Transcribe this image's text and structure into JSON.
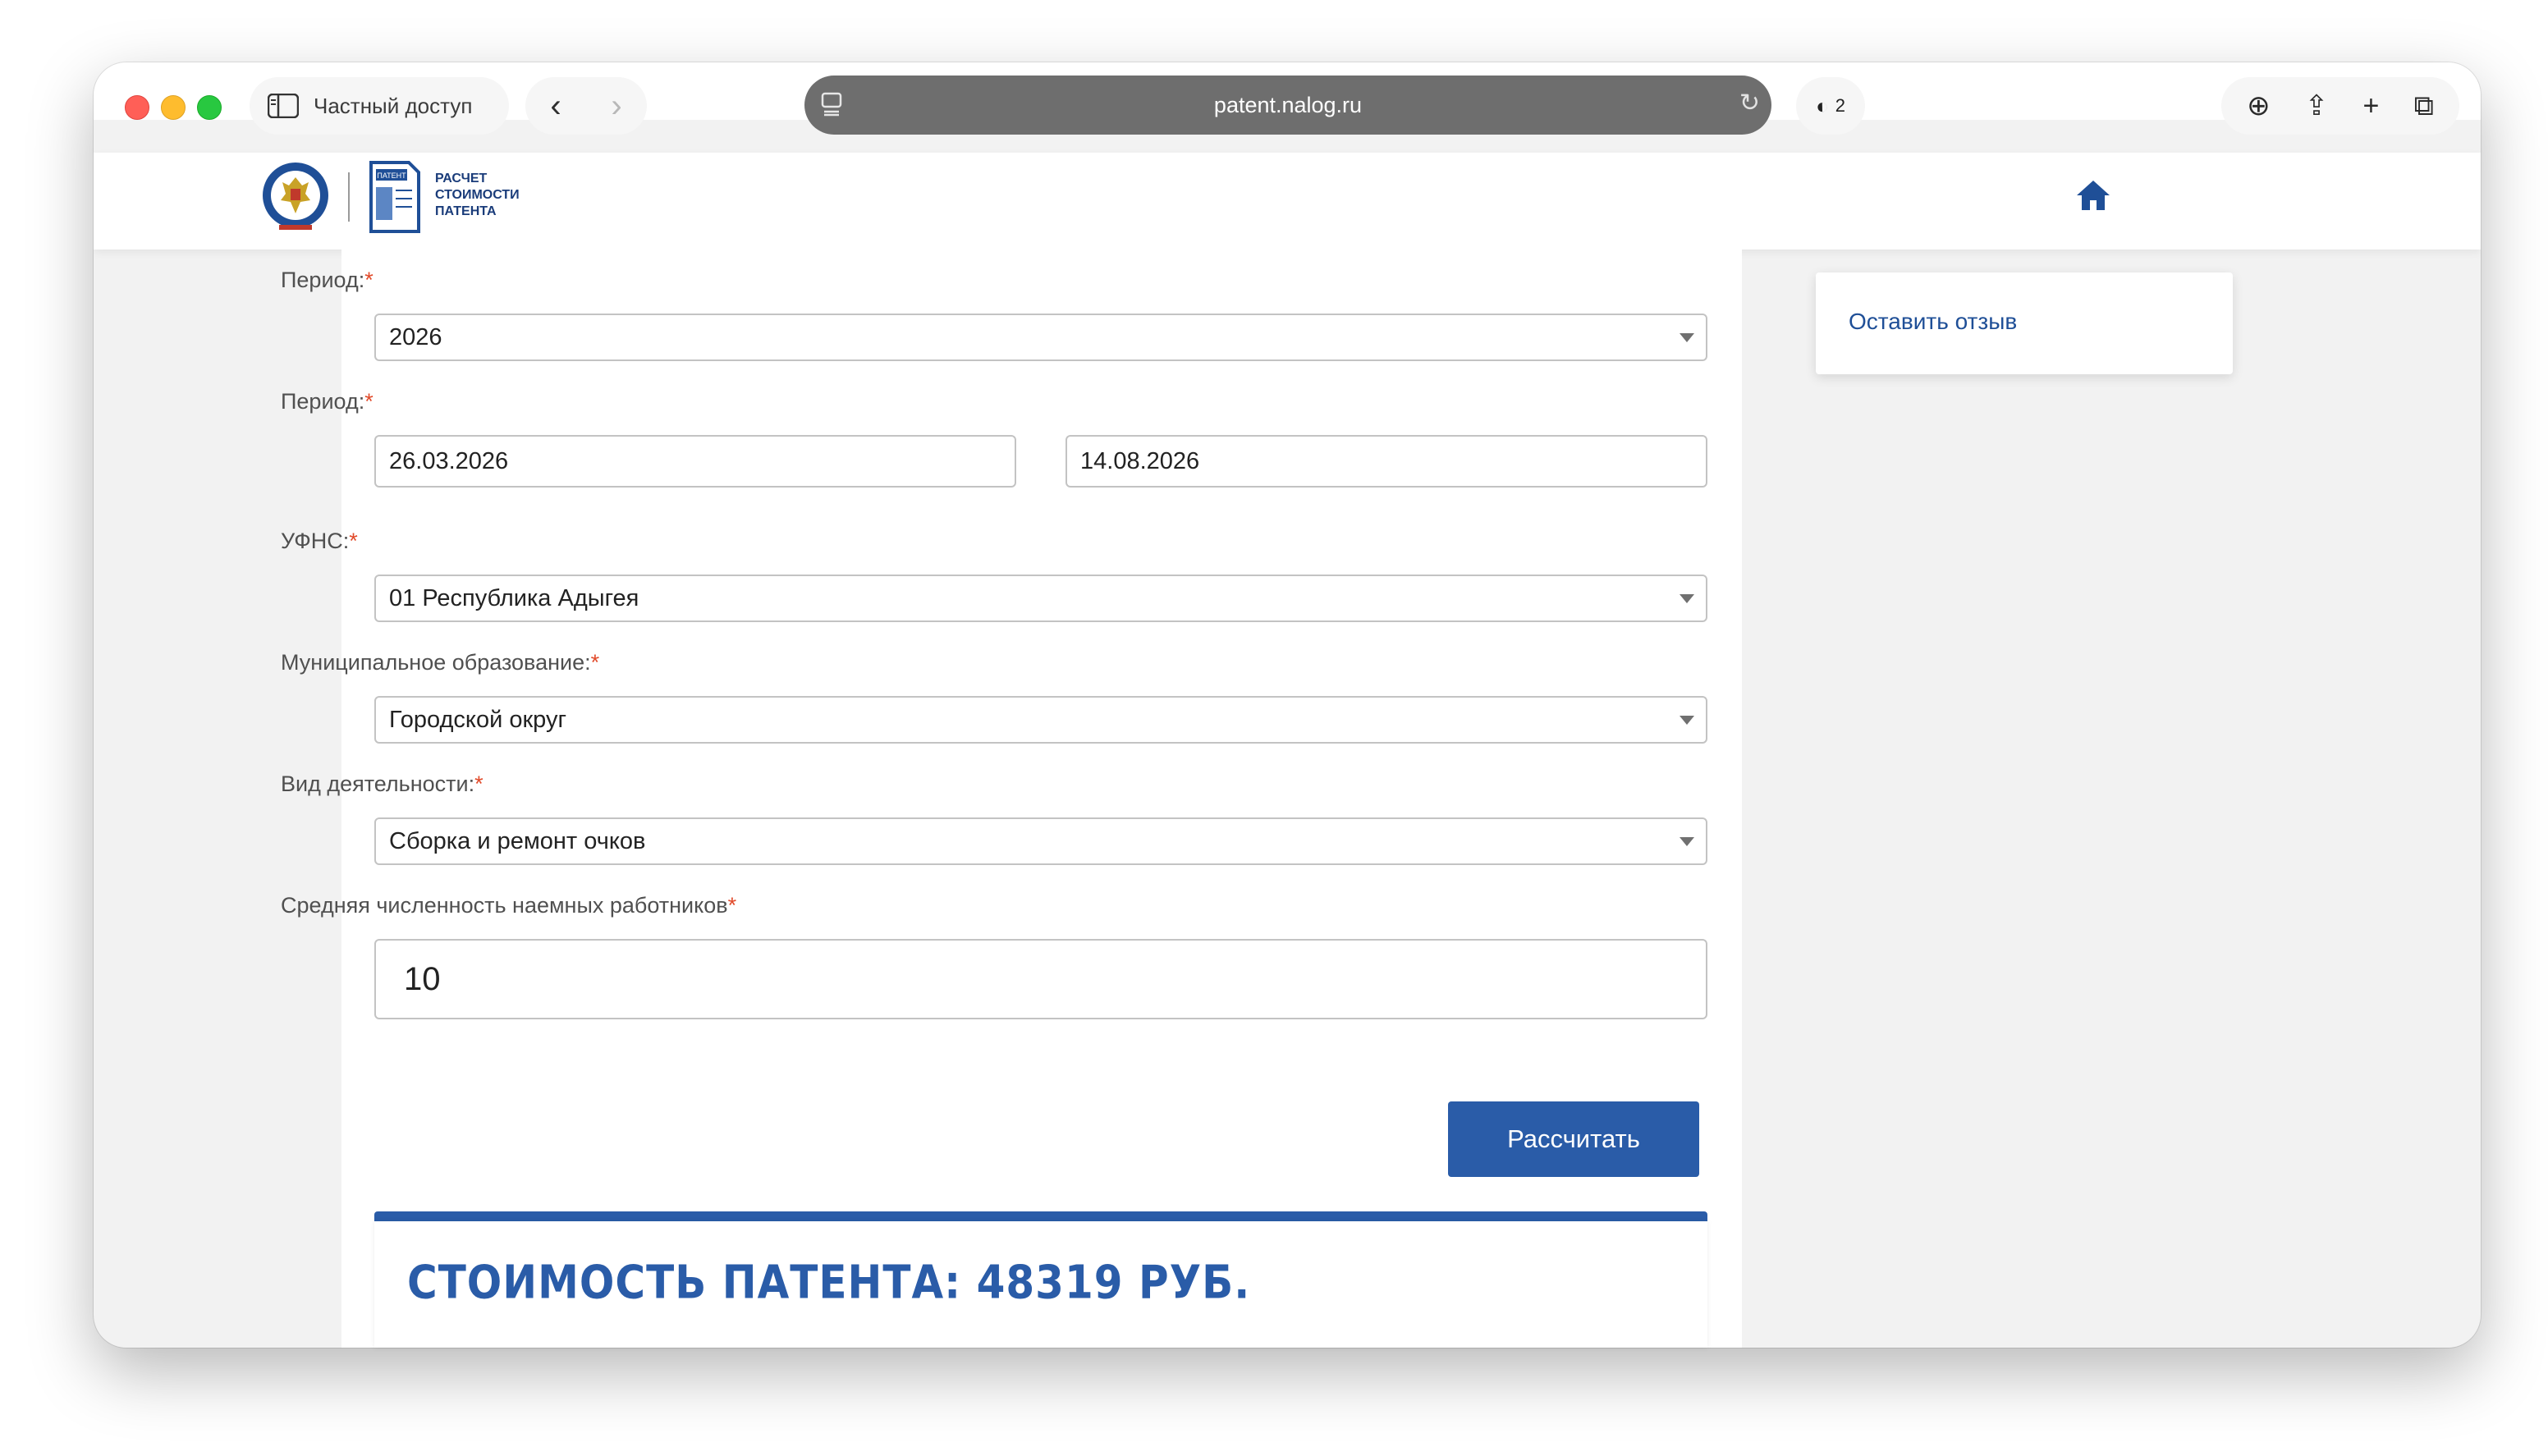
{
  "browser": {
    "private_label": "Частный доступ",
    "url": "patent.nalog.ru",
    "shield_count": "2"
  },
  "header": {
    "logo_text_line1": "ПАТЕНТ",
    "logo_text": [
      "РАСЧЕТ",
      "СТОИМОСТИ",
      "ПАТЕНТА"
    ]
  },
  "form": {
    "period_label": "Период:",
    "period_value": "2026",
    "period_range_label": "Период:",
    "date_from": "26.03.2026",
    "date_to": "14.08.2026",
    "ufns_label": "УФНС:",
    "ufns_value": "01 Республика Адыгея",
    "municipality_label": "Муниципальное образование:",
    "municipality_value": "Городской округ",
    "activity_label": "Вид деятельности:",
    "activity_value": "Сборка и ремонт очков",
    "employees_label": "Средняя численность наемных работников",
    "employees_value": "10",
    "required_mark": "*",
    "submit_label": "Рассчитать"
  },
  "result": {
    "text": "СТОИМОСТЬ ПАТЕНТА: 48319 РУБ."
  },
  "sidebar": {
    "feedback_label": "Оставить отзыв"
  },
  "colors": {
    "accent": "#2a5ca8",
    "required": "#e14a2a"
  }
}
